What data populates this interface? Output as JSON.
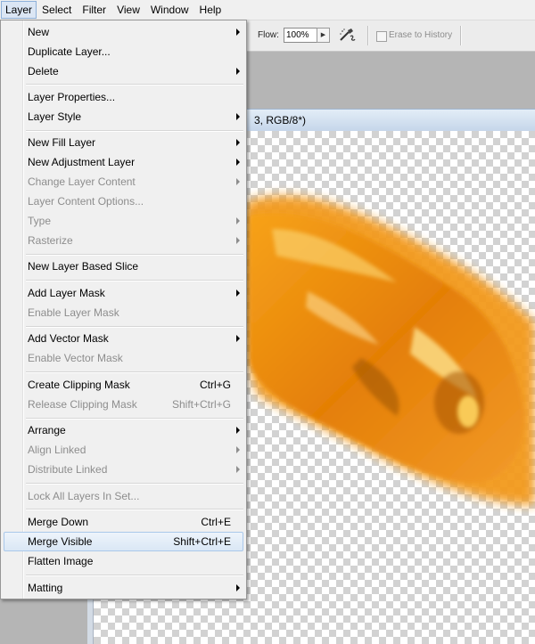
{
  "menubar": {
    "items": [
      {
        "label": "Layer"
      },
      {
        "label": "Select"
      },
      {
        "label": "Filter"
      },
      {
        "label": "View"
      },
      {
        "label": "Window"
      },
      {
        "label": "Help"
      }
    ]
  },
  "options_bar": {
    "flow_label": "Flow:",
    "flow_value": "100%",
    "erase_to_history_label": "Erase to History",
    "erase_to_history_checked": false,
    "airbrush_icon": "airbrush-icon"
  },
  "document": {
    "title_fragment": "3, RGB/8*)"
  },
  "layer_menu": {
    "items": [
      {
        "label": "New",
        "submenu": true,
        "enabled": true
      },
      {
        "label": "Duplicate Layer...",
        "enabled": true
      },
      {
        "label": "Delete",
        "submenu": true,
        "enabled": true
      },
      {
        "separator": true
      },
      {
        "label": "Layer Properties...",
        "enabled": true
      },
      {
        "label": "Layer Style",
        "submenu": true,
        "enabled": true
      },
      {
        "separator": true
      },
      {
        "label": "New Fill Layer",
        "submenu": true,
        "enabled": true
      },
      {
        "label": "New Adjustment Layer",
        "submenu": true,
        "enabled": true
      },
      {
        "label": "Change Layer Content",
        "submenu": true,
        "enabled": false
      },
      {
        "label": "Layer Content Options...",
        "enabled": false
      },
      {
        "label": "Type",
        "submenu": true,
        "enabled": false
      },
      {
        "label": "Rasterize",
        "submenu": true,
        "enabled": false
      },
      {
        "separator": true
      },
      {
        "label": "New Layer Based Slice",
        "enabled": true
      },
      {
        "separator": true
      },
      {
        "label": "Add Layer Mask",
        "submenu": true,
        "enabled": true
      },
      {
        "label": "Enable Layer Mask",
        "enabled": false
      },
      {
        "separator": true
      },
      {
        "label": "Add Vector Mask",
        "submenu": true,
        "enabled": true
      },
      {
        "label": "Enable Vector Mask",
        "enabled": false
      },
      {
        "separator": true
      },
      {
        "label": "Create Clipping Mask",
        "shortcut": "Ctrl+G",
        "enabled": true
      },
      {
        "label": "Release Clipping Mask",
        "shortcut": "Shift+Ctrl+G",
        "enabled": false
      },
      {
        "separator": true
      },
      {
        "label": "Arrange",
        "submenu": true,
        "enabled": true
      },
      {
        "label": "Align Linked",
        "submenu": true,
        "enabled": false
      },
      {
        "label": "Distribute Linked",
        "submenu": true,
        "enabled": false
      },
      {
        "separator": true
      },
      {
        "label": "Lock All Layers In Set...",
        "enabled": false
      },
      {
        "separator": true
      },
      {
        "label": "Merge Down",
        "shortcut": "Ctrl+E",
        "enabled": true
      },
      {
        "label": "Merge Visible",
        "shortcut": "Shift+Ctrl+E",
        "enabled": true,
        "highlighted": true
      },
      {
        "label": "Flatten Image",
        "enabled": true
      },
      {
        "separator": true
      },
      {
        "label": "Matting",
        "submenu": true,
        "enabled": true
      }
    ]
  },
  "colors": {
    "menu_bg": "#f0f0f0",
    "disabled_text": "#8d8d8d",
    "highlight": "#dae7f5",
    "flame": "#f08a00"
  }
}
